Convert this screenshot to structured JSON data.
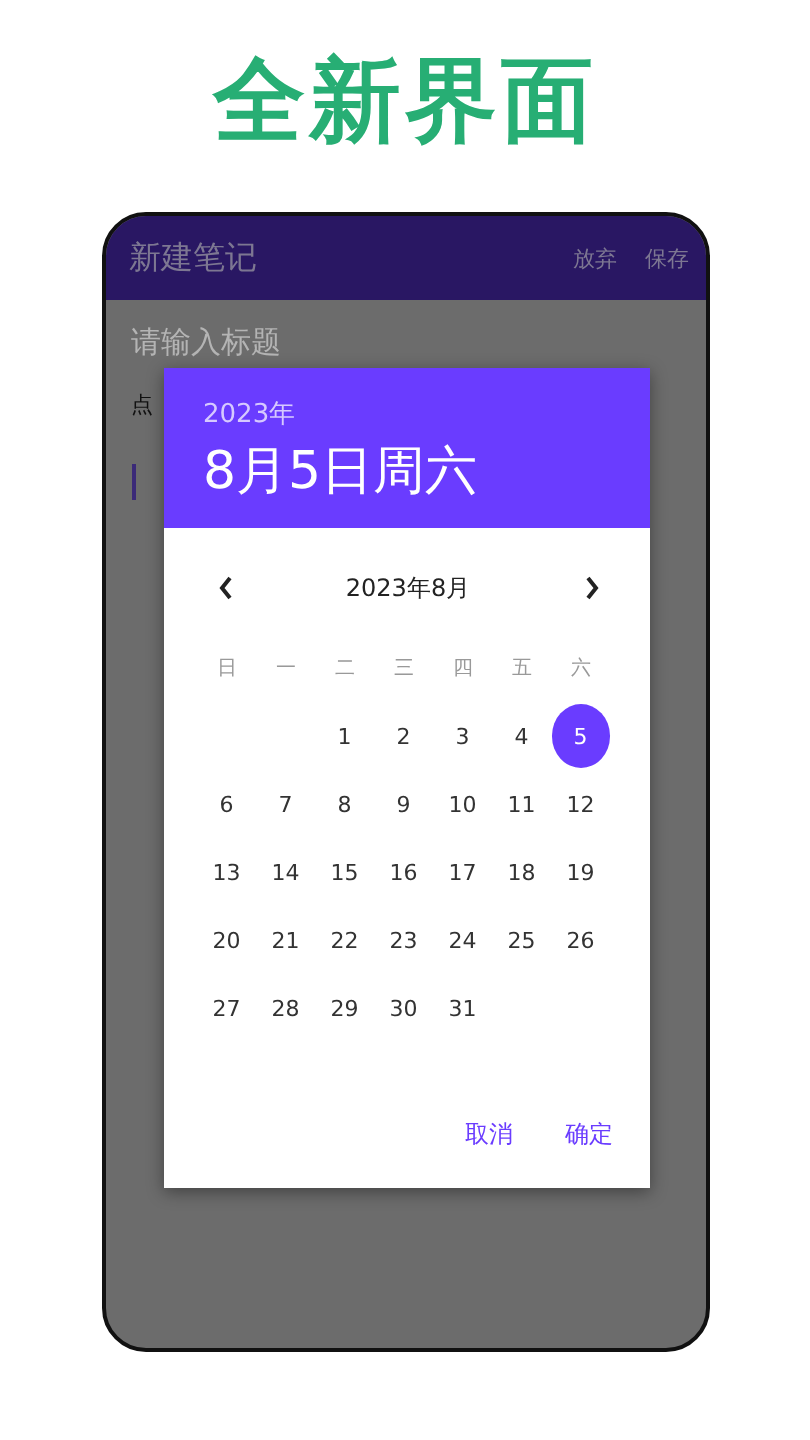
{
  "headline": "全新界面",
  "app_bar": {
    "title": "新建笔记",
    "actions": [
      "放弃",
      "保存"
    ]
  },
  "editor": {
    "title_placeholder": "请输入标题",
    "hint": "点"
  },
  "date_picker": {
    "year": "2023年",
    "date": "8月5日周六",
    "month": "2023年8月",
    "weekdays": [
      "日",
      "一",
      "二",
      "三",
      "四",
      "五",
      "六"
    ],
    "days": [
      {
        "kind": "blank"
      },
      {
        "kind": "blank"
      },
      {
        "kind": "day",
        "label": "1",
        "selected": false
      },
      {
        "kind": "day",
        "label": "2",
        "selected": false
      },
      {
        "kind": "day",
        "label": "3",
        "selected": false
      },
      {
        "kind": "day",
        "label": "4",
        "selected": false
      },
      {
        "kind": "day",
        "label": "5",
        "selected": true
      },
      {
        "kind": "day",
        "label": "6",
        "selected": false
      },
      {
        "kind": "day",
        "label": "7",
        "selected": false
      },
      {
        "kind": "day",
        "label": "8",
        "selected": false
      },
      {
        "kind": "day",
        "label": "9",
        "selected": false
      },
      {
        "kind": "day",
        "label": "10",
        "selected": false
      },
      {
        "kind": "day",
        "label": "11",
        "selected": false
      },
      {
        "kind": "day",
        "label": "12",
        "selected": false
      },
      {
        "kind": "day",
        "label": "13",
        "selected": false
      },
      {
        "kind": "day",
        "label": "14",
        "selected": false
      },
      {
        "kind": "day",
        "label": "15",
        "selected": false
      },
      {
        "kind": "day",
        "label": "16",
        "selected": false
      },
      {
        "kind": "day",
        "label": "17",
        "selected": false
      },
      {
        "kind": "day",
        "label": "18",
        "selected": false
      },
      {
        "kind": "day",
        "label": "19",
        "selected": false
      },
      {
        "kind": "day",
        "label": "20",
        "selected": false
      },
      {
        "kind": "day",
        "label": "21",
        "selected": false
      },
      {
        "kind": "day",
        "label": "22",
        "selected": false
      },
      {
        "kind": "day",
        "label": "23",
        "selected": false
      },
      {
        "kind": "day",
        "label": "24",
        "selected": false
      },
      {
        "kind": "day",
        "label": "25",
        "selected": false
      },
      {
        "kind": "day",
        "label": "26",
        "selected": false
      },
      {
        "kind": "day",
        "label": "27",
        "selected": false
      },
      {
        "kind": "day",
        "label": "28",
        "selected": false
      },
      {
        "kind": "day",
        "label": "29",
        "selected": false
      },
      {
        "kind": "day",
        "label": "30",
        "selected": false
      },
      {
        "kind": "day",
        "label": "31",
        "selected": false
      }
    ],
    "buttons": [
      "取消",
      "确定"
    ]
  }
}
